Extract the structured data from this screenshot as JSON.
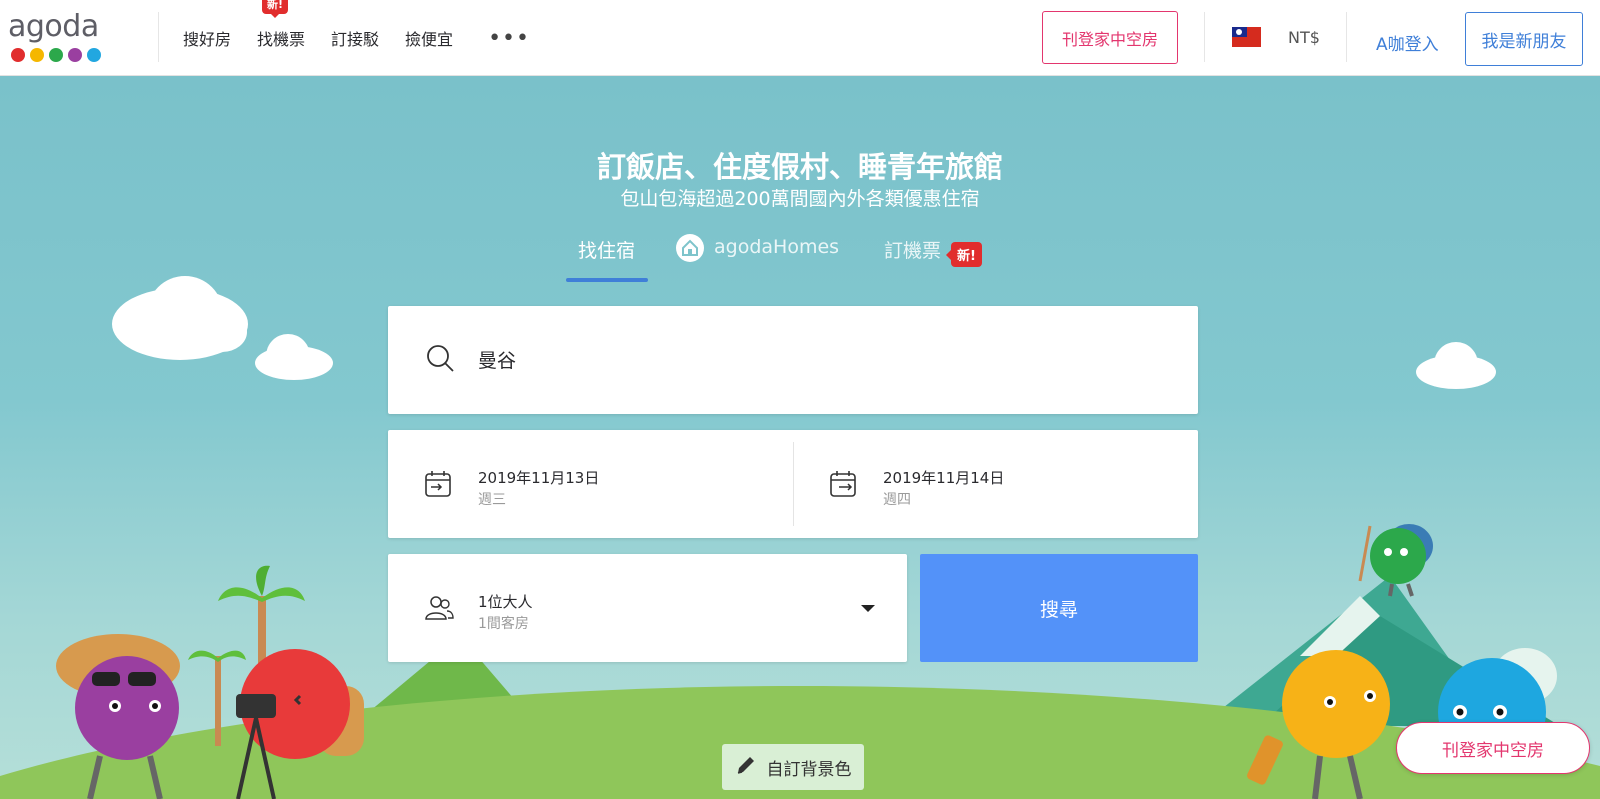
{
  "colors": {
    "accent_blue": "#5392f9",
    "pink": "#e3366e",
    "badge_red": "#e12d2d",
    "sky": "#7ec4cb",
    "grass": "#8fc65a"
  },
  "logo": {
    "text": "agoda",
    "dots": [
      "#e12d2d",
      "#f5b700",
      "#2ca84b",
      "#9a3fa0",
      "#22a7e0"
    ]
  },
  "nav": {
    "items": [
      {
        "label": "搜好房"
      },
      {
        "label": "找機票",
        "badge": "新!"
      },
      {
        "label": "訂接駁"
      },
      {
        "label": "撿便宜"
      }
    ],
    "more": "•••"
  },
  "header": {
    "list_property": "刊登家中空房",
    "currency": "NT$",
    "flag_icon": "taiwan-flag-icon",
    "login": "A咖登入",
    "signup": "我是新朋友"
  },
  "hero": {
    "title": "訂飯店、住度假村、睡青年旅館",
    "subtitle": "包山包海超過200萬間國內外各類優惠住宿"
  },
  "tabs": [
    {
      "label": "找住宿",
      "active": true
    },
    {
      "label": "agodaHomes",
      "icon": "house-icon"
    },
    {
      "label": "訂機票",
      "badge": "新!"
    }
  ],
  "search": {
    "value": "曼谷",
    "icon": "search-icon"
  },
  "dates": {
    "checkin": {
      "date": "2019年11月13日",
      "weekday": "週三",
      "icon": "calendar-checkin-icon"
    },
    "checkout": {
      "date": "2019年11月14日",
      "weekday": "週四",
      "icon": "calendar-checkout-icon"
    }
  },
  "guests": {
    "adults": "1位大人",
    "rooms": "1間客房",
    "icon": "people-icon"
  },
  "search_button": "搜尋",
  "customize_bg": {
    "label": "自訂背景色",
    "icon": "pencil-icon"
  },
  "floating_list_property": "刊登家中空房"
}
